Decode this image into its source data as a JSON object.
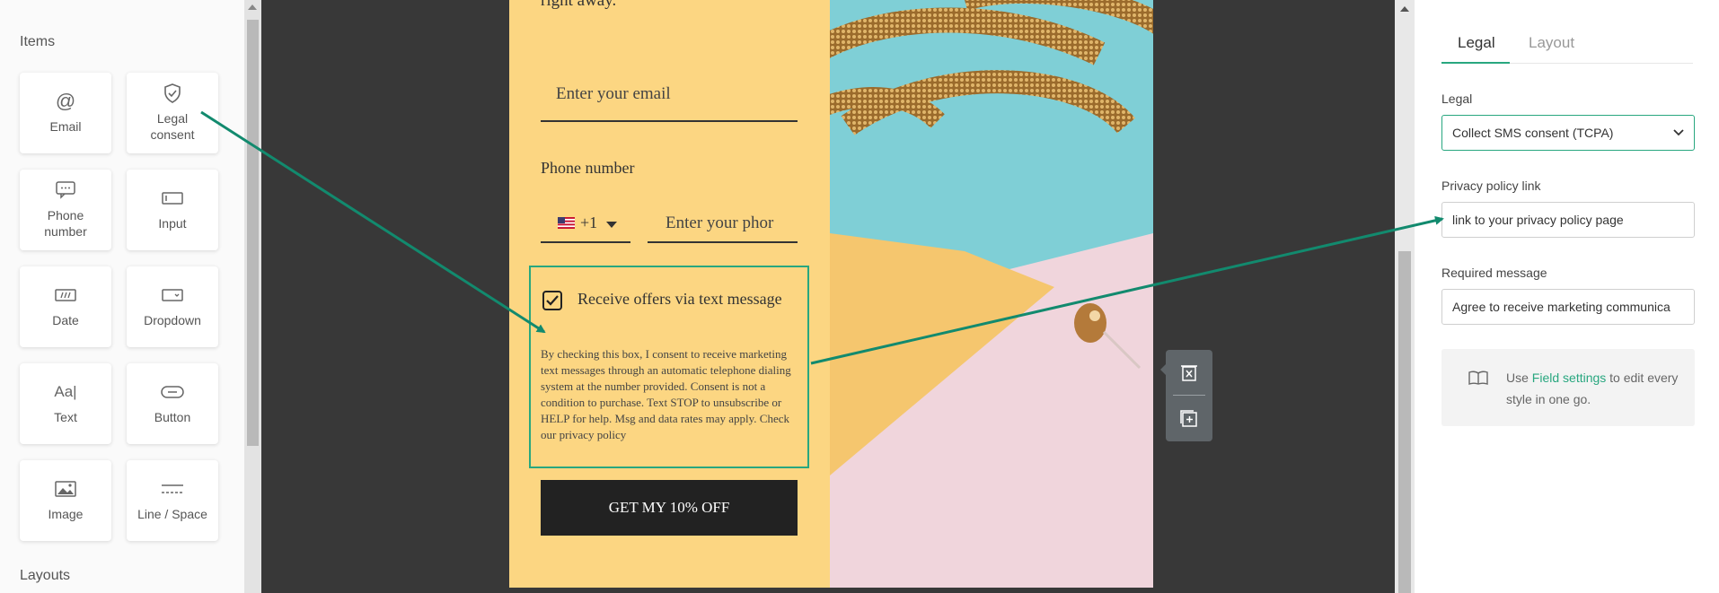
{
  "sidebar": {
    "items_title": "Items",
    "layouts_title": "Layouts",
    "items": [
      {
        "label": "Email",
        "icon": "at-icon"
      },
      {
        "label": "Legal consent",
        "icon": "shield-check-icon"
      },
      {
        "label": "Phone number",
        "icon": "sms-icon"
      },
      {
        "label": "Input",
        "icon": "input-field-icon"
      },
      {
        "label": "Date",
        "icon": "calendar-icon"
      },
      {
        "label": "Dropdown",
        "icon": "dropdown-icon"
      },
      {
        "label": "Text",
        "icon": "text-icon"
      },
      {
        "label": "Button",
        "icon": "button-icon"
      },
      {
        "label": "Image",
        "icon": "image-icon"
      },
      {
        "label": "Line / Space",
        "icon": "divider-icon"
      }
    ]
  },
  "popup": {
    "headline_tail": "right away.",
    "email_placeholder": "Enter your email",
    "phone_label": "Phone number",
    "country_code": "+1",
    "phone_placeholder": "Enter your phor",
    "consent_title": "Receive offers via text message",
    "consent_body": "By checking this box, I consent to receive marketing text messages through an automatic telephone dialing system at the number provided. Consent is not a condition to purchase. Text STOP to unsubscribe or HELP for help. Msg and data rates may apply. Check our privacy policy",
    "cta_label": "GET MY 10% OFF"
  },
  "toolbox": {
    "delete_icon": "delete-icon",
    "duplicate_icon": "duplicate-icon"
  },
  "settings": {
    "tabs": [
      "Legal",
      "Layout"
    ],
    "active_tab": "Legal",
    "legal_label": "Legal",
    "legal_value": "Collect SMS consent (TCPA)",
    "privacy_label": "Privacy policy link",
    "privacy_value": "link to your privacy policy page",
    "required_label": "Required message",
    "required_value": "Agree to receive marketing communica",
    "info_prefix": "Use",
    "info_link": "Field settings",
    "info_suffix": "to edit every style in one go."
  },
  "colors": {
    "accent": "#28a77f",
    "form_background": "#fcd682",
    "canvas_background": "#383838",
    "cta_background": "#222222"
  }
}
